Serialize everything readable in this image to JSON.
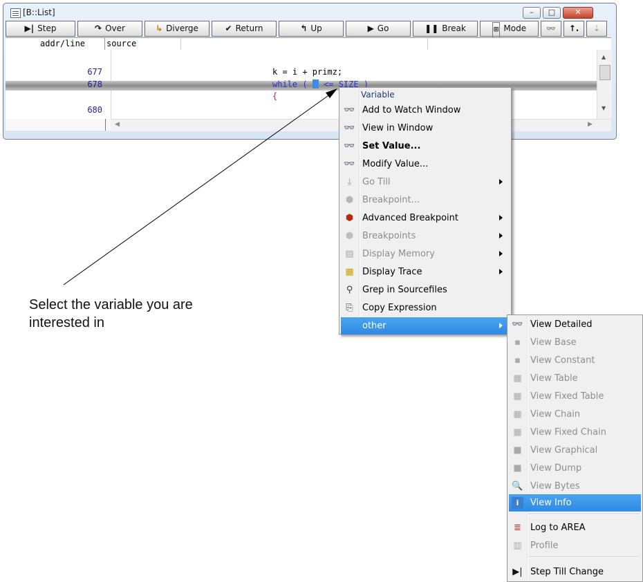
{
  "window": {
    "title": "[B::List]",
    "controls": {
      "minimize": "–",
      "maximize": "□",
      "close": "✕"
    }
  },
  "toolbar": {
    "step": "Step",
    "over": "Over",
    "diverge": "Diverge",
    "return": "Return",
    "up": "Up",
    "go": "Go",
    "break": "Break",
    "mode": "Mode"
  },
  "list": {
    "col_addr": "addr/line",
    "col_source": "source",
    "rows": [
      {
        "line": "677",
        "code": "k = i + primz;"
      },
      {
        "line": "678",
        "code_prefix": "while ( ",
        "code_suffix": " <= SIZE )"
      },
      {
        "line": "",
        "code": "{"
      },
      {
        "line": "680",
        "code": ""
      }
    ]
  },
  "annotation": {
    "line1": "Select the variable you are",
    "line2": "interested in"
  },
  "context_menu": {
    "header": "Variable",
    "items": [
      {
        "label": "Add to Watch Window",
        "enabled": true,
        "icon": "watch-glasses-plus-icon"
      },
      {
        "label": "View in Window",
        "enabled": true,
        "icon": "glasses-icon"
      },
      {
        "label": "Set Value...",
        "enabled": true,
        "bold": true,
        "icon": "glasses-set-icon"
      },
      {
        "label": "Modify Value...",
        "enabled": true,
        "icon": "glasses-modify-icon"
      },
      {
        "label": "Go Till",
        "enabled": false,
        "submenu": true,
        "icon": "go-till-icon"
      },
      {
        "label": "Breakpoint...",
        "enabled": false,
        "icon": "breakpoint-icon"
      },
      {
        "label": "Advanced Breakpoint",
        "enabled": true,
        "submenu": true,
        "icon": "advanced-breakpoint-icon"
      },
      {
        "label": "Breakpoints",
        "enabled": false,
        "submenu": true,
        "icon": "breakpoints-icon"
      },
      {
        "label": "Display Memory",
        "enabled": false,
        "submenu": true,
        "icon": "memory-icon"
      },
      {
        "label": "Display Trace",
        "enabled": true,
        "submenu": true,
        "icon": "trace-icon"
      },
      {
        "label": "Grep in Sourcefiles",
        "enabled": true,
        "icon": "binoculars-icon"
      },
      {
        "label": "Copy Expression",
        "enabled": true,
        "icon": "copy-icon"
      },
      {
        "label": "other",
        "enabled": true,
        "submenu": true,
        "selected": true,
        "icon": ""
      }
    ]
  },
  "submenu": {
    "items": [
      {
        "label": "View Detailed",
        "enabled": true,
        "bold": true
      },
      {
        "label": "View Base",
        "enabled": false
      },
      {
        "label": "View Constant",
        "enabled": false
      },
      {
        "label": "View Table",
        "enabled": false
      },
      {
        "label": "View Fixed Table",
        "enabled": false
      },
      {
        "label": "View Chain",
        "enabled": false
      },
      {
        "label": "View Fixed Chain",
        "enabled": false
      },
      {
        "label": "View Graphical",
        "enabled": false
      },
      {
        "label": "View Dump",
        "enabled": false
      },
      {
        "label": "View Bytes",
        "enabled": false
      },
      {
        "label": "View Info",
        "enabled": true,
        "selected": true
      },
      {
        "label": "Log to AREA",
        "enabled": true
      },
      {
        "label": "Profile",
        "enabled": false
      },
      {
        "label": "Step Till Change",
        "enabled": true
      }
    ]
  },
  "colors": {
    "highlight": "#3390e8",
    "line_numbers": "#1d1d9f",
    "keyword": "#2a33d6",
    "brace": "#d6127a",
    "disabled_text": "#8d8d8d"
  }
}
